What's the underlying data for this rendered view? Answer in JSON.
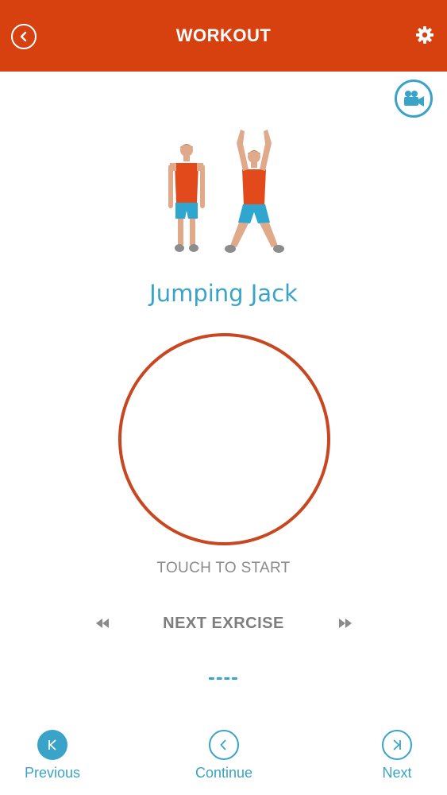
{
  "header": {
    "title": "WORKOUT",
    "back_icon": "chevron-left-icon",
    "settings_icon": "gear-icon",
    "background_color": "#d7410f"
  },
  "video": {
    "icon": "video-camera-icon"
  },
  "exercise": {
    "name": "Jumping Jack",
    "illustration": "jumping-jack-figures"
  },
  "start": {
    "label": "TOUCH TO START",
    "ring_color": "#c84620"
  },
  "next_exercise": {
    "title": "NEXT EXRCISE",
    "value": "----",
    "rewind_icon": "rewind-icon",
    "forward_icon": "fast-forward-icon"
  },
  "nav": {
    "items": [
      {
        "label": "Previous",
        "icon": "skip-back-icon"
      },
      {
        "label": "Continue",
        "icon": "chevron-left-icon"
      },
      {
        "label": "Next",
        "icon": "skip-forward-icon"
      }
    ]
  },
  "colors": {
    "accent": "#3aa3c8",
    "muted_text": "#8a8a8a"
  }
}
